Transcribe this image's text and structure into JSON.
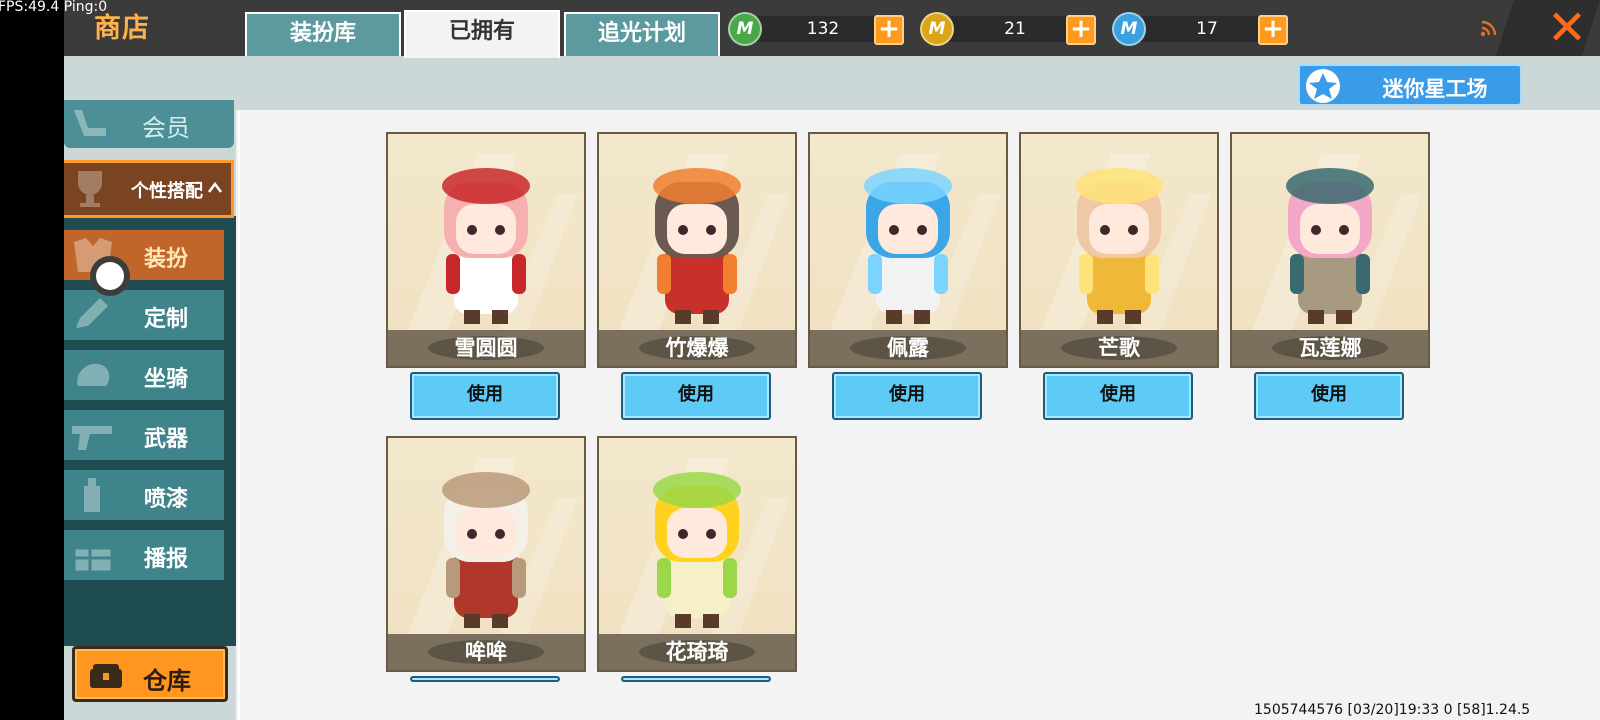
{
  "debug": {
    "fps_text": "FPS:49.4  Ping:0"
  },
  "header": {
    "title": "商店"
  },
  "currencies": [
    {
      "name": "mini-bean",
      "icon": "m-coin-green-icon",
      "amount": "132",
      "color": "#49a84a"
    },
    {
      "name": "mini-coin",
      "icon": "m-coin-gold-icon",
      "amount": "21",
      "color": "#d9a618"
    },
    {
      "name": "mini-point",
      "icon": "m-coin-blue-icon",
      "amount": "17",
      "color": "#3aa0e0"
    }
  ],
  "coin_glyph": "M",
  "plus_glyph": "+",
  "close_glyph": "✕",
  "sidebar": {
    "member_label": "会员",
    "outfit_group_label": "个性搭配",
    "items": [
      {
        "label": "装扮",
        "icon": "outfit-icon",
        "active": true
      },
      {
        "label": "定制",
        "icon": "pencil-icon",
        "active": false
      },
      {
        "label": "坐骑",
        "icon": "mount-icon",
        "active": false
      },
      {
        "label": "武器",
        "icon": "gun-icon",
        "active": false
      },
      {
        "label": "喷漆",
        "icon": "spray-can-icon",
        "active": false
      },
      {
        "label": "播报",
        "icon": "gift-icon",
        "active": false
      }
    ],
    "warehouse_label": "仓库"
  },
  "tabs": [
    {
      "label": "装扮库",
      "active": false
    },
    {
      "label": "已拥有",
      "active": true
    },
    {
      "label": "追光计划",
      "active": false
    }
  ],
  "workshop_label": "迷你星工场",
  "use_label": "使用",
  "outfits": [
    {
      "name": "雪圆圆",
      "hair": "#f7b0b0",
      "body": "#ffffff",
      "accent": "#c9282a"
    },
    {
      "name": "竹爆爆",
      "hair": "#6a5a52",
      "body": "#c8302a",
      "accent": "#f08030"
    },
    {
      "name": "佩露",
      "hair": "#3aa6e8",
      "body": "#f2f2f2",
      "accent": "#7bd4ff"
    },
    {
      "name": "芒歌",
      "hair": "#f0c8a8",
      "body": "#f0b838",
      "accent": "#ffe27a"
    },
    {
      "name": "瓦莲娜",
      "hair": "#f4a8c8",
      "body": "#a89a80",
      "accent": "#3a6a70"
    },
    {
      "name": "哞哞",
      "hair": "#f3f0e8",
      "body": "#b0382a",
      "accent": "#b89a7a"
    },
    {
      "name": "花琦琦",
      "hair": "#ffd21e",
      "body": "#f6f0c8",
      "accent": "#9ad84a"
    }
  ],
  "footer": {
    "info": "1505744576   [03/20]19:33 0   [58]1.24.5"
  }
}
